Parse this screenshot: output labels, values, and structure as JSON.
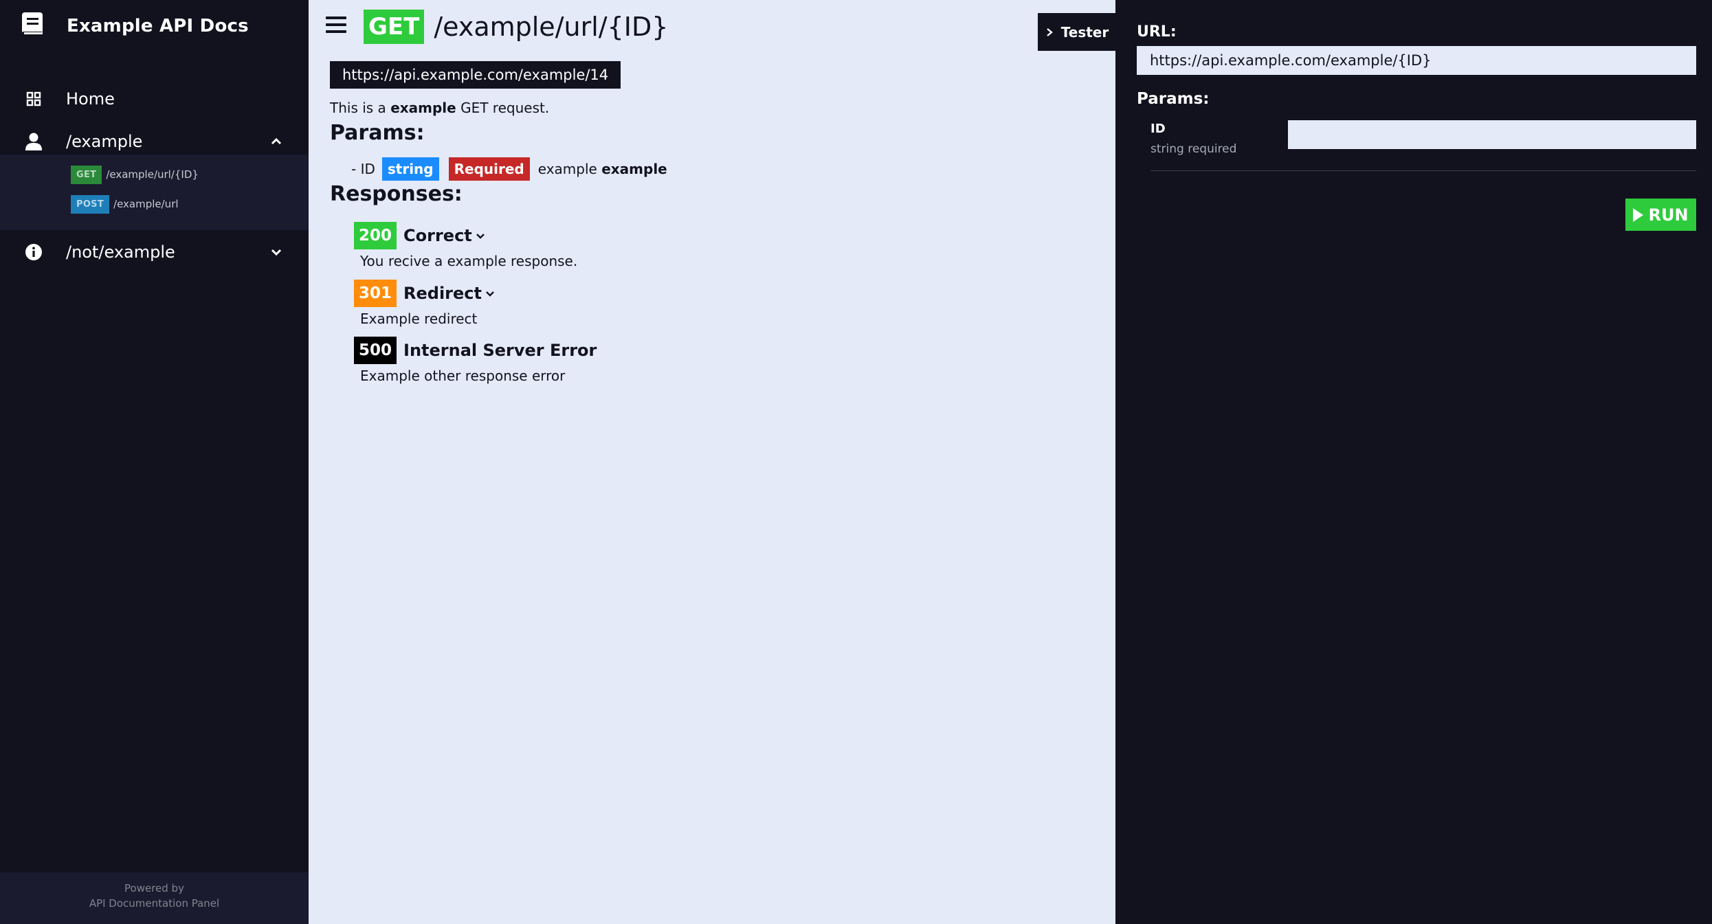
{
  "sidebar": {
    "brand_title": "Example API Docs",
    "items": [
      {
        "label": "Home",
        "icon": "grid-icon"
      },
      {
        "label": "/example",
        "icon": "user-icon",
        "expanded": true
      },
      {
        "label": "/not/example",
        "icon": "info-icon",
        "expanded": false
      }
    ],
    "sub_items": [
      {
        "method": "GET",
        "path": "/example/url/{ID}"
      },
      {
        "method": "POST",
        "path": "/example/url"
      }
    ],
    "footer_line1": "Powered by",
    "footer_line2": "API Documentation Panel"
  },
  "main": {
    "method": "GET",
    "title": "/example/url/{ID}",
    "url": "https://api.example.com/example/14",
    "desc_pre": "This is a",
    "desc_bold": "example",
    "desc_post": "GET request.",
    "params_heading": "Params:",
    "param": {
      "prefix": "- ID",
      "type": "string",
      "required": "Required",
      "example_label": "example",
      "example_value": "example"
    },
    "responses_heading": "Responses:",
    "responses": [
      {
        "code": "200",
        "name": "Correct",
        "desc": "You recive a example response.",
        "expandable": true,
        "color": "#2ecb3c"
      },
      {
        "code": "301",
        "name": "Redirect",
        "desc": "Example redirect",
        "expandable": true,
        "color": "#ff8c0a"
      },
      {
        "code": "500",
        "name": "Internal Server Error",
        "desc": "Example other response error",
        "expandable": false,
        "color": "#000000"
      }
    ]
  },
  "tester": {
    "toggle_label": "Tester",
    "url_label": "URL:",
    "url_value": "https://api.example.com/example/{ID}",
    "params_label": "Params:",
    "param_name": "ID",
    "param_type": "string required",
    "param_value": "",
    "run_label": "RUN"
  },
  "colors": {
    "sidebar_bg": "#12121f",
    "main_bg": "#e4eaf7",
    "get_green": "#2ecb3c",
    "post_blue": "#1e7fb8",
    "type_blue": "#1a8cff",
    "required_red": "#c62828",
    "redirect_orange": "#ff8c0a"
  }
}
